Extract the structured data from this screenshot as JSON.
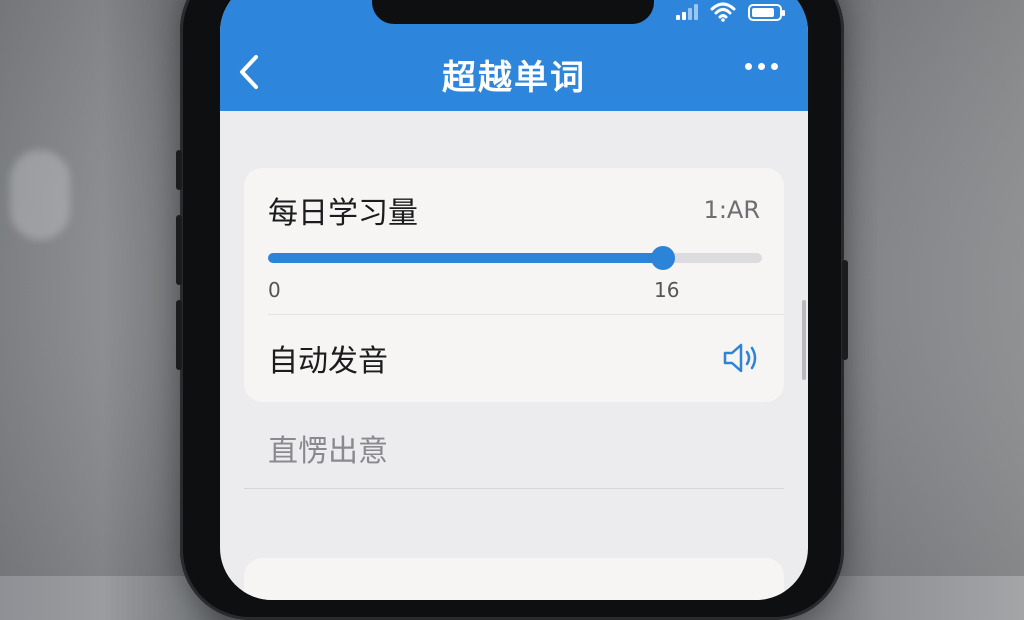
{
  "header": {
    "title": "超越单词",
    "back_icon": "chevron-left-icon",
    "more_icon": "more-horizontal-icon",
    "background": "#2d86db"
  },
  "status_bar": {
    "icons": [
      "signal-icon",
      "wifi-icon",
      "battery-icon"
    ],
    "signal_bars_on": 2,
    "battery_level": 0.85
  },
  "settings": {
    "daily_amount": {
      "label": "每日学习量",
      "value_text": "1:AR",
      "slider": {
        "min_label": "0",
        "max_label": "16",
        "min": 0,
        "max": 16,
        "value": 16,
        "fill_fraction": 0.8
      }
    },
    "auto_pronounce": {
      "label": "自动发音",
      "icon": "speaker-icon"
    },
    "plain_row": {
      "label": "直愣出意"
    }
  },
  "colors": {
    "accent": "#2c84d8",
    "screen_bg": "#ecebed",
    "card_bg": "#f6f5f3"
  }
}
